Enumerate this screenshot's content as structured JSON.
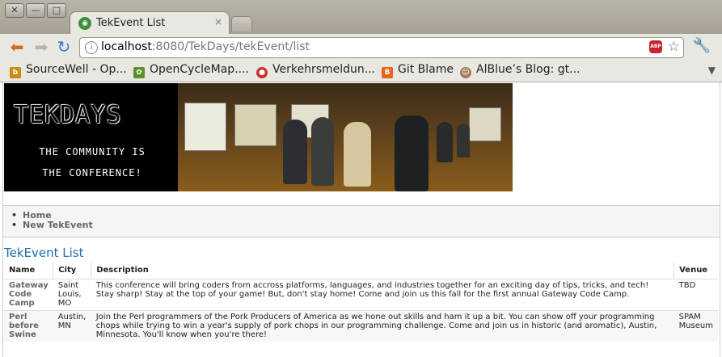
{
  "browser": {
    "tab_title": "TekEvent List",
    "tab_close": "×",
    "url_host": "localhost",
    "url_rest": ":8080/TekDays/tekEvent/list",
    "window_buttons": [
      "✕",
      "—",
      "□"
    ],
    "back_icon": "arrow-left",
    "forward_icon": "arrow-right",
    "reload_icon": "reload",
    "abp_label": "ABP"
  },
  "bookmarks": [
    {
      "label": "SourceWell - Op...",
      "icon": "b",
      "color": "#c98a10"
    },
    {
      "label": "OpenCycleMap....",
      "icon": "✿",
      "color": "#5a8f2a"
    },
    {
      "label": "Verkehrsmeldun...",
      "icon": "●",
      "color": "#c8342b"
    },
    {
      "label": "Git Blame",
      "icon": "B",
      "color": "#e8641b"
    },
    {
      "label": "AlBlue’s Blog: gt...",
      "icon": "☺",
      "color": "#a77d5a"
    }
  ],
  "banner": {
    "logo_text": "TEKDAYS",
    "tagline_line1": "THE COMMUNITY IS",
    "tagline_line2": "THE CONFERENCE!"
  },
  "nav": {
    "items": [
      "Home",
      "New TekEvent"
    ]
  },
  "page": {
    "title": "TekEvent List"
  },
  "table": {
    "headers": [
      "Name",
      "City",
      "Description",
      "Venue"
    ],
    "rows": [
      {
        "name": "Gateway Code Camp",
        "city": "Saint Louis, MO",
        "description": "This conference will bring coders from accross platforms, languages, and industries together for an exciting day of tips, tricks, and tech! Stay sharp! Stay at the top of your game! But, don't stay home! Come and join us this fall for the first annual Gateway Code Camp.",
        "venue": "TBD"
      },
      {
        "name": "Perl before Swine",
        "city": "Austin, MN",
        "description": "Join the Perl programmers of the Pork Producers of America as we hone out skills and ham it up a bit. You can show off your programming chops while trying to win a year's supply of pork chops in our programming challenge. Come and join us in historic (and aromatic), Austin, Minnesota. You'll know when you're there!",
        "venue": "SPAM Museum"
      }
    ]
  }
}
